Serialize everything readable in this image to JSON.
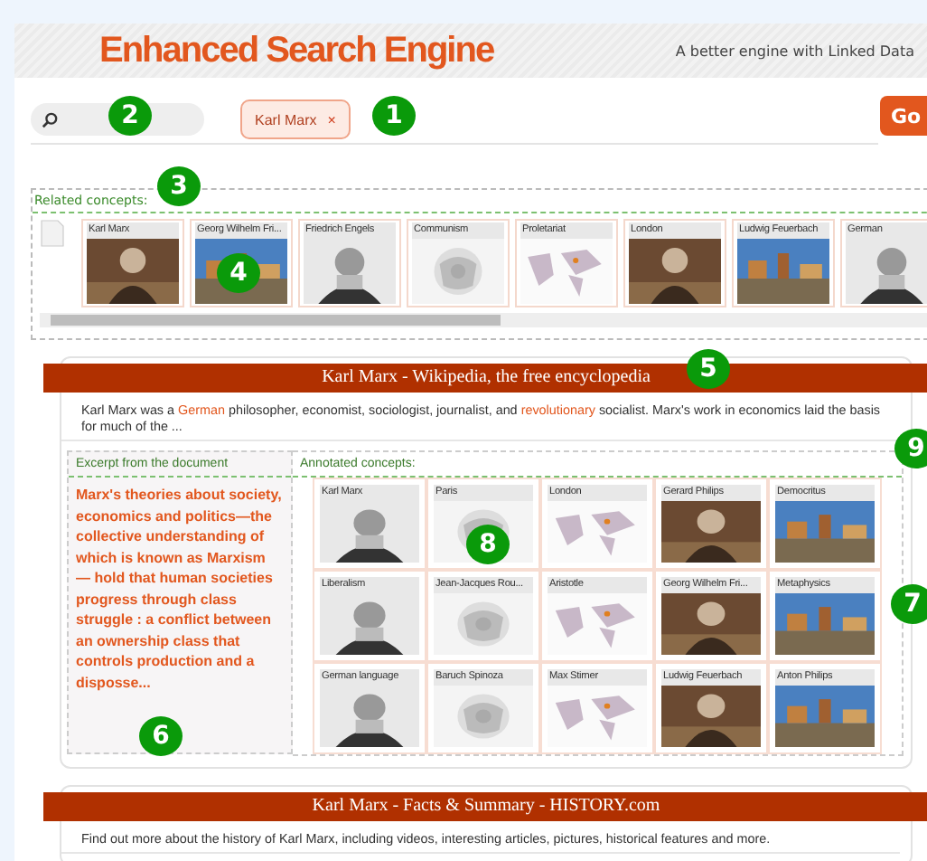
{
  "header": {
    "title": "Enhanced Search Engine",
    "tagline": "A better engine with Linked Data"
  },
  "search": {
    "tag": "Karl Marx",
    "tag_remove": "×",
    "go": "Go"
  },
  "related": {
    "label": "Related concepts:",
    "items": [
      "Karl Marx",
      "Georg Wilhelm Fri...",
      "Friedrich Engels",
      "Communism",
      "Proletariat",
      "London",
      "Ludwig Feuerbach",
      "German"
    ]
  },
  "results": [
    {
      "title": "Karl Marx - Wikipedia, the free encyclopedia",
      "snippet": [
        {
          "text": "Karl Marx was a ",
          "link": false
        },
        {
          "text": "German",
          "link": true
        },
        {
          "text": " philosopher, economist, sociologist, journalist, and ",
          "link": false
        },
        {
          "text": "revolutionary",
          "link": true
        },
        {
          "text": " socialist. Marx's work in economics laid the basis for much of the ...",
          "link": false
        }
      ],
      "excerpt_label": "Excerpt from the document",
      "excerpt": "Marx's theories about society, economics and politics—the collective understanding of which is known as Marxism — hold that human societies progress through class struggle : a conflict between an ownership class that controls production and a disposse...",
      "annotated_label": "Annotated concepts:",
      "concepts": [
        "Karl Marx",
        "Paris",
        "London",
        "Gerard Philips",
        "Democritus",
        "Liberalism",
        "Jean-Jacques Rou...",
        "Aristotle",
        "Georg Wilhelm Fri...",
        "Metaphysics",
        "German language",
        "Baruch Spinoza",
        "Max Stirner",
        "Ludwig Feuerbach",
        "Anton Philips"
      ]
    },
    {
      "title": "Karl Marx - Facts & Summary - HISTORY.com",
      "snippet": [
        {
          "text": "Find out more about the history of Karl Marx, including videos, interesting articles, pictures, historical features and more.",
          "link": false
        }
      ]
    }
  ],
  "callouts": [
    "1",
    "2",
    "3",
    "4",
    "5",
    "6",
    "7",
    "8",
    "9"
  ]
}
